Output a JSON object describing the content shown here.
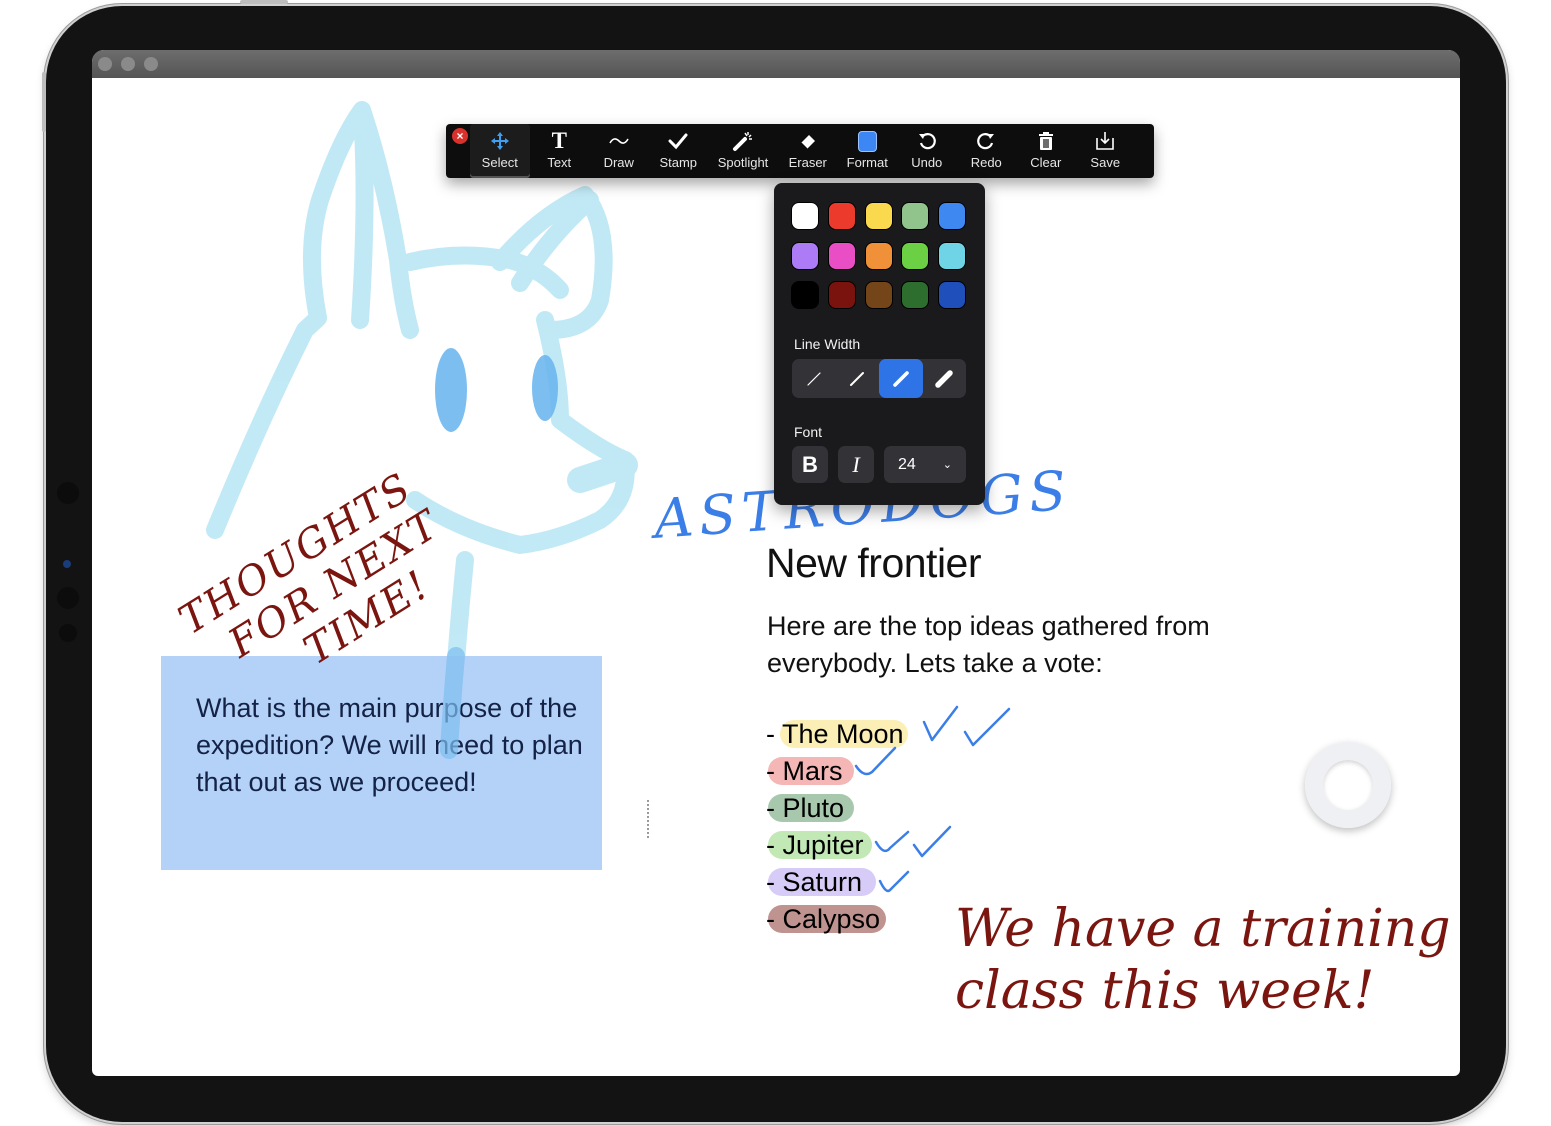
{
  "toolbar": {
    "close_icon": "close-icon",
    "items": [
      {
        "label": "Select",
        "icon": "move-arrows-icon",
        "active": true
      },
      {
        "label": "Text",
        "icon": "text-icon"
      },
      {
        "label": "Draw",
        "icon": "draw-icon"
      },
      {
        "label": "Stamp",
        "icon": "checkmark-icon"
      },
      {
        "label": "Spotlight",
        "icon": "magic-wand-icon"
      },
      {
        "label": "Eraser",
        "icon": "eraser-icon"
      },
      {
        "label": "Format",
        "icon": "format-color-icon"
      },
      {
        "label": "Undo",
        "icon": "undo-icon"
      },
      {
        "label": "Redo",
        "icon": "redo-icon"
      },
      {
        "label": "Clear",
        "icon": "trash-icon"
      },
      {
        "label": "Save",
        "icon": "save-icon"
      }
    ],
    "format_color": "#3d87f5"
  },
  "format_panel": {
    "colors": [
      [
        "#ffffff",
        "#ec3b2d",
        "#fbd94f",
        "#91c48d",
        "#3e88f1"
      ],
      [
        "#ad7bf5",
        "#e94ec4",
        "#f0913a",
        "#6cd045",
        "#6fd5e6"
      ],
      [
        "#000000",
        "#7a130d",
        "#744518",
        "#2d6d2d",
        "#1f4fba"
      ]
    ],
    "line_width_label": "Line Width",
    "line_widths": [
      "thin",
      "medium",
      "thick",
      "extra-thick"
    ],
    "selected_line_width": 2,
    "font_label": "Font",
    "bold_label": "B",
    "italic_label": "I",
    "font_size": "24"
  },
  "document": {
    "heading": "New frontier",
    "paragraph": "Here are the top ideas gathered from everybody. Lets take a vote:",
    "list": [
      {
        "text": "- The Moon",
        "highlight": "#f9e27a",
        "votes": 2
      },
      {
        "text": "- Mars",
        "highlight": "#ec7a7a",
        "votes": 1
      },
      {
        "text": "- Pluto",
        "highlight": "#5f9a6a",
        "votes": 0
      },
      {
        "text": "- Jupiter",
        "highlight": "#8fd67a",
        "votes": 2
      },
      {
        "text": "- Saturn",
        "highlight": "#b7a0f0",
        "votes": 1
      },
      {
        "text": "- Calypso",
        "highlight": "#8a3a33",
        "votes": 0
      }
    ],
    "note": "What is the main purpose of the expedition? We will need to plan that out as we proceed!"
  },
  "annotations": {
    "astro": "ASTRODOGS",
    "thoughts_lines": [
      "THOUGHTS",
      "FOR NEXT",
      "TIME!"
    ],
    "training_lines": [
      "We have a training",
      "class this week!"
    ],
    "ink_red": "#7a150f",
    "ink_blue": "#3b7ee8",
    "ink_cyan": "#8fd8ee"
  }
}
